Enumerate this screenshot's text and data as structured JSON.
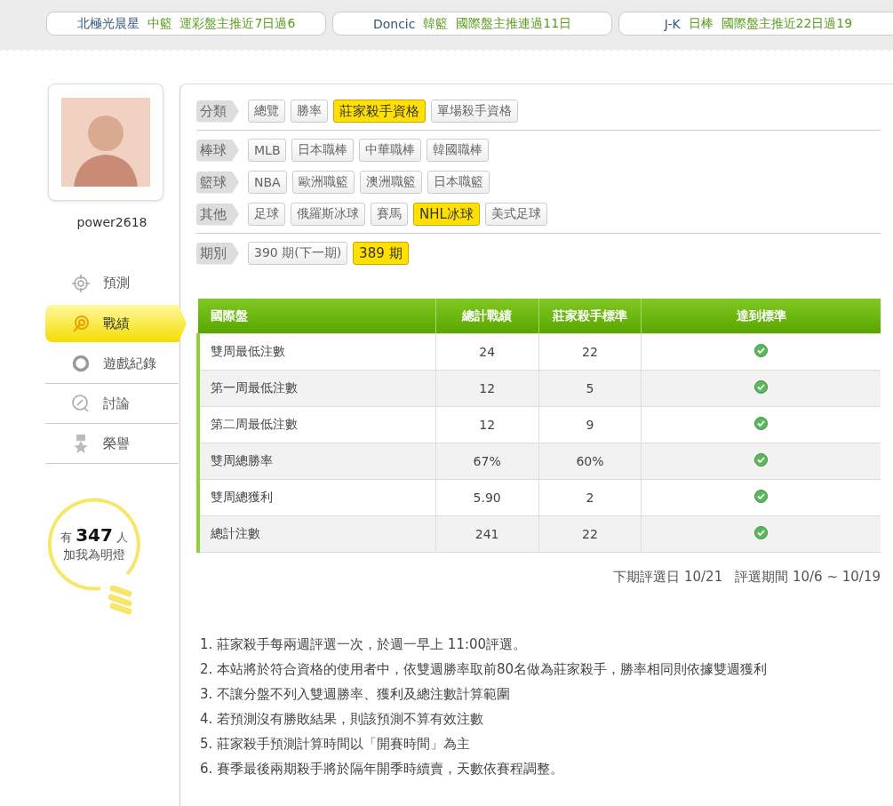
{
  "ticker": [
    {
      "name": "北極光晨星",
      "league": "中籃",
      "text": "運彩盤主推近7日過6"
    },
    {
      "name": "Doncic",
      "league": "韓籃",
      "text": "國際盤主推連過11日"
    },
    {
      "name": "J-K",
      "league": "日棒",
      "text": "國際盤主推近22日過19"
    }
  ],
  "user": {
    "username": "power2618"
  },
  "menu": [
    {
      "label": "預測",
      "selected": false
    },
    {
      "label": "戰績",
      "selected": true
    },
    {
      "label": "遊戲紀錄",
      "selected": false
    },
    {
      "label": "討論",
      "selected": false
    },
    {
      "label": "榮譽",
      "selected": false
    }
  ],
  "fans": {
    "prefix": "有",
    "count": "347",
    "suffix": "人",
    "caption": "加我為明燈"
  },
  "filter_sections": [
    {
      "groups": [
        {
          "label": "分類",
          "options": [
            {
              "label": "總覽",
              "selected": false
            },
            {
              "label": "勝率",
              "selected": false
            },
            {
              "label": "莊家殺手資格",
              "selected": true
            },
            {
              "label": "單場殺手資格",
              "selected": false
            }
          ]
        }
      ]
    },
    {
      "groups": [
        {
          "label": "棒球",
          "options": [
            {
              "label": "MLB",
              "selected": false
            },
            {
              "label": "日本職棒",
              "selected": false
            },
            {
              "label": "中華職棒",
              "selected": false
            },
            {
              "label": "韓國職棒",
              "selected": false
            }
          ]
        },
        {
          "label": "籃球",
          "options": [
            {
              "label": "NBA",
              "selected": false
            },
            {
              "label": "歐洲職籃",
              "selected": false
            },
            {
              "label": "澳洲職籃",
              "selected": false
            },
            {
              "label": "日本職籃",
              "selected": false
            }
          ]
        },
        {
          "label": "其他",
          "options": [
            {
              "label": "足球",
              "selected": false
            },
            {
              "label": "俄羅斯冰球",
              "selected": false
            },
            {
              "label": "賽馬",
              "selected": false
            },
            {
              "label": "NHL冰球",
              "selected": true
            },
            {
              "label": "美式足球",
              "selected": false
            }
          ]
        }
      ]
    },
    {
      "groups": [
        {
          "label": "期別",
          "options": [
            {
              "label": "390 期(下一期)",
              "selected": false
            },
            {
              "label": "389 期",
              "selected": true
            }
          ]
        }
      ]
    }
  ],
  "table": {
    "columns": [
      "國際盤",
      "總計戰績",
      "莊家殺手標準",
      "達到標準"
    ],
    "rows": [
      {
        "item": "雙周最低注數",
        "total": "24",
        "standard": "22",
        "met": true
      },
      {
        "item": "第一周最低注數",
        "total": "12",
        "standard": "5",
        "met": true
      },
      {
        "item": "第二周最低注數",
        "total": "12",
        "standard": "9",
        "met": true
      },
      {
        "item": "雙周總勝率",
        "total": "67%",
        "standard": "60%",
        "met": true
      },
      {
        "item": "雙周總獲利",
        "total": "5.90",
        "standard": "2",
        "met": true
      },
      {
        "item": "總計注數",
        "total": "241",
        "standard": "22",
        "met": true
      }
    ]
  },
  "period_info": [
    "下期評選日 10/21",
    "評選期間 10/6 ~ 10/19"
  ],
  "notes": [
    "1. 莊家殺手每兩週評選一次，於週一早上 11:00評選。",
    "2. 本站將於符合資格的使用者中，依雙週勝率取前80名做為莊家殺手，勝率相同則依據雙週獲利",
    "3. 不讓分盤不列入雙週勝率、獲利及總注數計算範圍",
    "4. 若預測沒有勝敗結果，則該預測不算有效注數",
    "5. 莊家殺手預測計算時間以「開賽時間」為主",
    "6. 賽季最後兩期殺手將於隔年開季時續賣，天數依賽程調整。"
  ]
}
